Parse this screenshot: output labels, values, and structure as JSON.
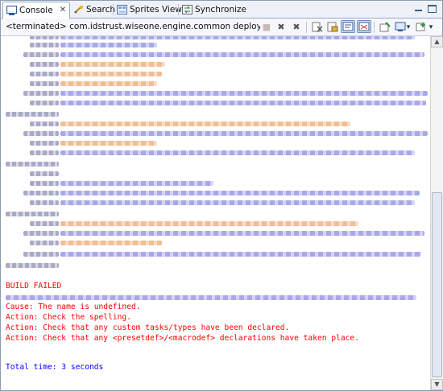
{
  "tabs": [
    {
      "label": "Console",
      "icon": "console-icon",
      "active": true
    },
    {
      "label": "Search",
      "icon": "search-icon"
    },
    {
      "label": "Sprites Viewer",
      "icon": "sprites-viewer-icon"
    },
    {
      "label": "Synchronize",
      "icon": "synchronize-icon"
    }
  ],
  "tab_close": "✕",
  "console_title": "<terminated> com.idstrust.wiseone.engine.common deploy_engine_all.xml [d",
  "toolbar_icons": {
    "terminate": "■",
    "remove_launch": "✖",
    "remove_all": "✖",
    "clear": "clear-console-icon",
    "scroll_lock": "scroll-lock-icon",
    "word_wrap": "word-wrap-icon",
    "show_console": "show-console-icon",
    "pin": "pin-console-icon",
    "display_selected": "display-console-icon",
    "open_console": "open-console-icon",
    "dropdown": "▾"
  },
  "console_lines": {
    "build_failed": "BUILD FAILED",
    "cause": "Cause: The name is undefined.",
    "action1": "Action: Check the spelling.",
    "action2": "Action: Check that any custom tasks/types have been declared.",
    "action3": "Action: Check that any <presetdef>/<macrodef> declarations have taken place.",
    "total_time": "Total time: 3 seconds"
  },
  "colors": {
    "error_text": "#ff0000",
    "info_text": "#0000ff",
    "accent": "#3a5b8a"
  }
}
